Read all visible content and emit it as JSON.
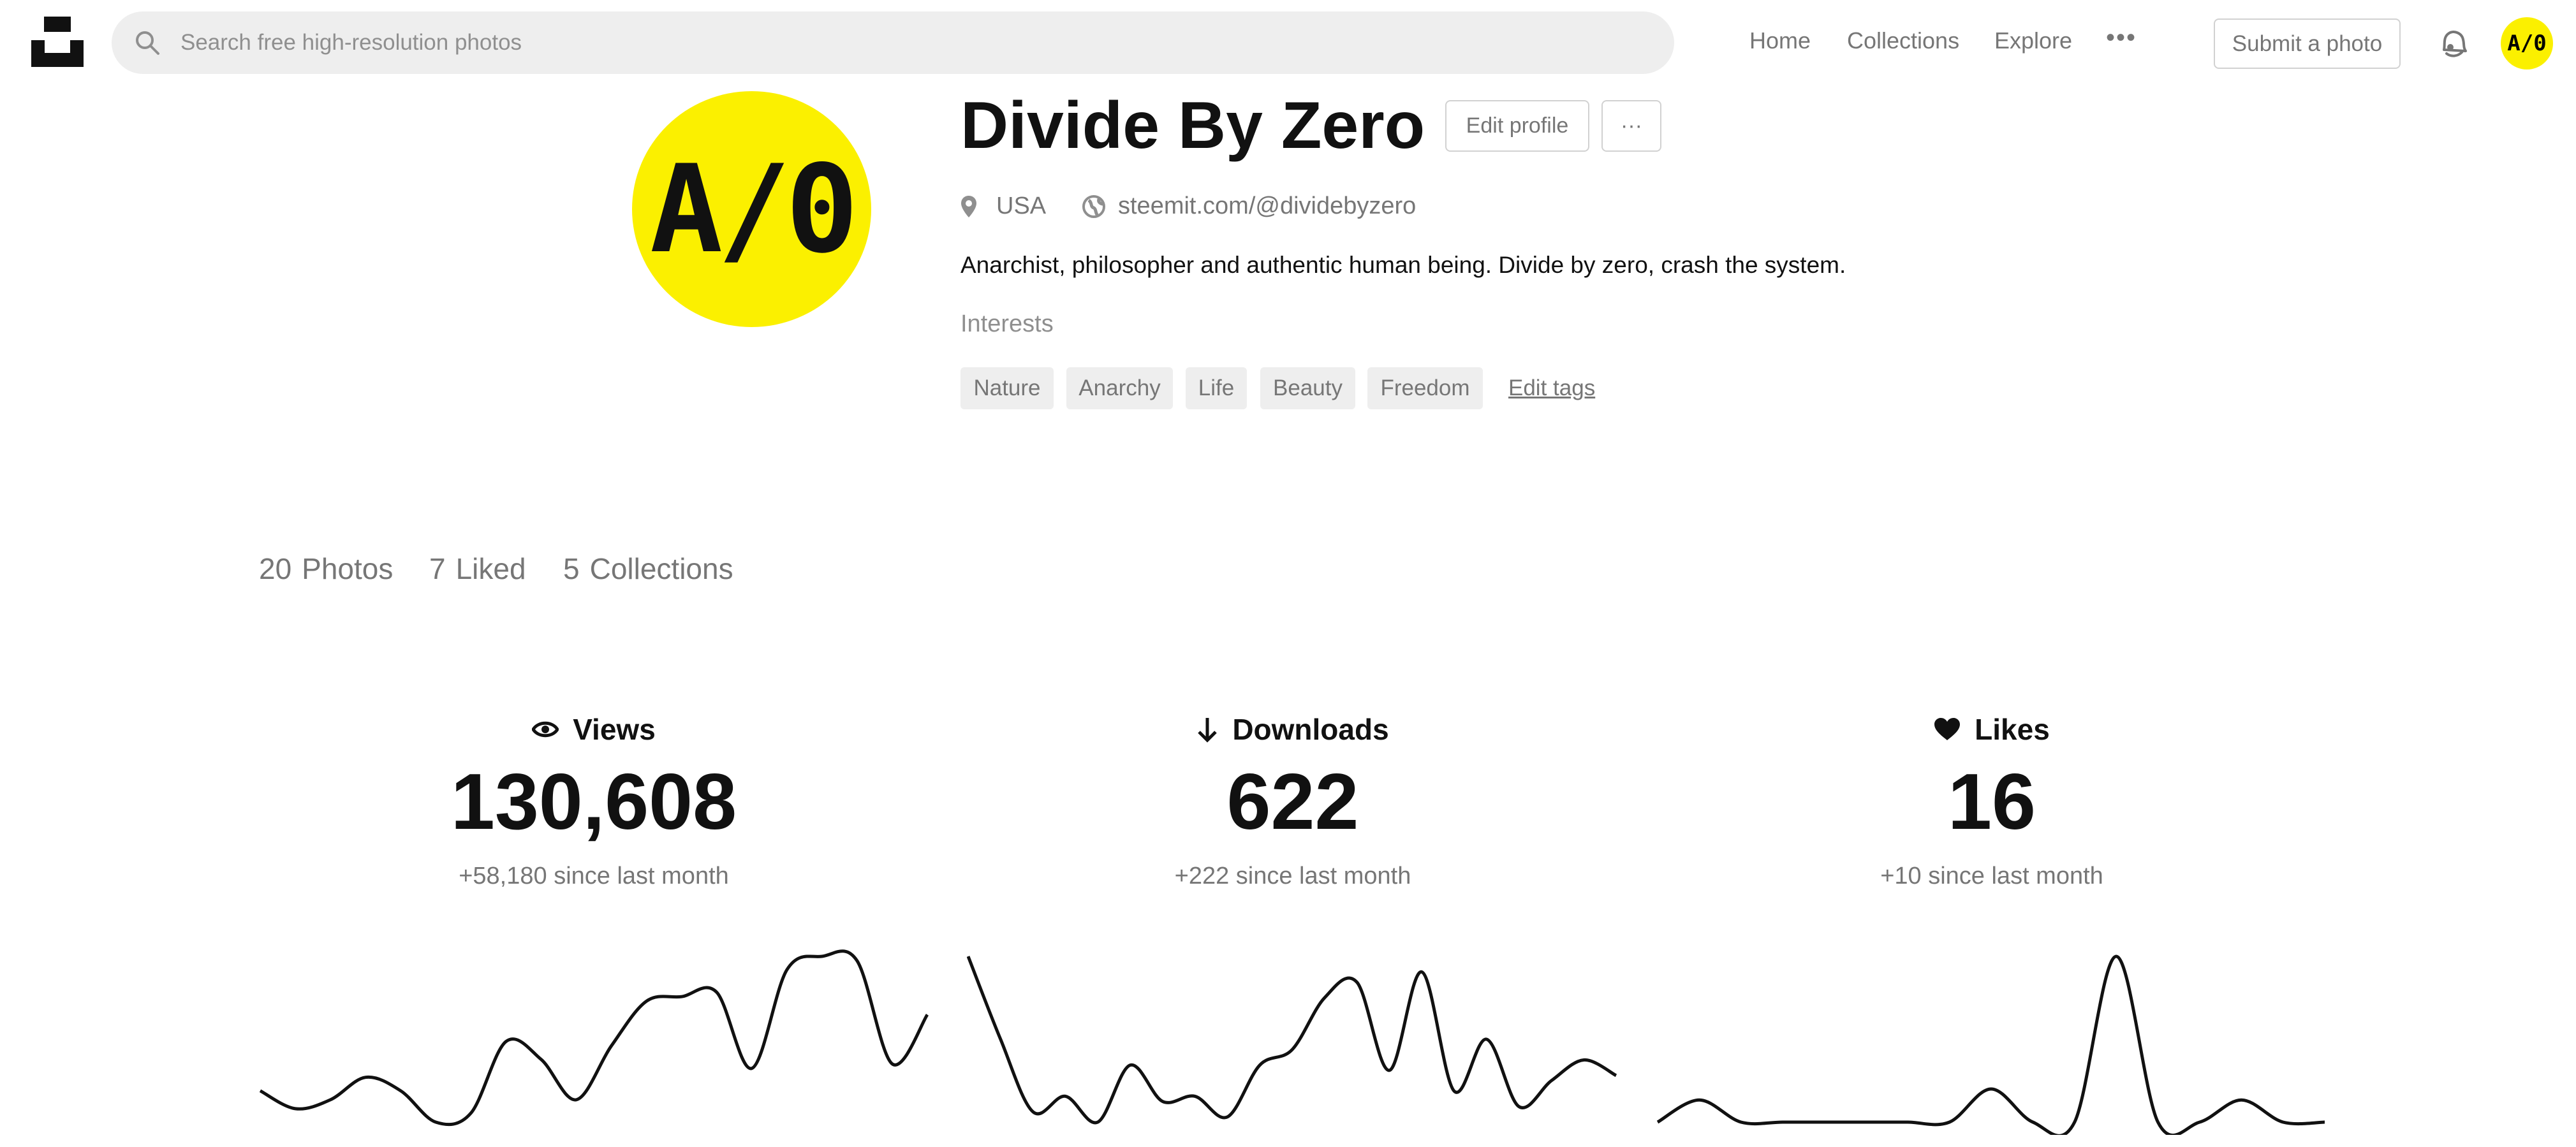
{
  "header": {
    "logo": "unsplash-logo",
    "search_placeholder": "Search free high-resolution photos",
    "nav": [
      "Home",
      "Collections",
      "Explore"
    ],
    "more_label": "•••",
    "submit_label": "Submit a photo",
    "avatar_text": "A/0"
  },
  "profile": {
    "avatar_text": "A/0",
    "name": "Divide By Zero",
    "edit_profile_label": "Edit profile",
    "more_label": "···",
    "location": "USA",
    "website": "steemit.com/@dividebyzero",
    "bio": "Anarchist, philosopher and authentic human being. Divide by zero, crash the system.",
    "interests_label": "Interests",
    "tags": [
      "Nature",
      "Anarchy",
      "Life",
      "Beauty",
      "Freedom"
    ],
    "edit_tags_label": "Edit tags",
    "accent_color": "#fbf000"
  },
  "counts": {
    "photos": {
      "value": "20",
      "label": "Photos"
    },
    "liked": {
      "value": "7",
      "label": "Liked"
    },
    "collections": {
      "value": "5",
      "label": "Collections"
    }
  },
  "stats": [
    {
      "icon": "eye-icon",
      "label": "Views",
      "value": "130,608",
      "change": "+58,180 since last month"
    },
    {
      "icon": "arrow-down-icon",
      "label": "Downloads",
      "value": "622",
      "change": "+222 since last month"
    },
    {
      "icon": "heart-icon",
      "label": "Likes",
      "value": "16",
      "change": "+10 since last month"
    }
  ],
  "chart_data": [
    {
      "type": "line",
      "name": "Views",
      "values": [
        9,
        5,
        7,
        12,
        9,
        2,
        4,
        20,
        16,
        7,
        19,
        29,
        30,
        31,
        14,
        36,
        39,
        38,
        15,
        26
      ]
    },
    {
      "type": "line",
      "name": "Downloads",
      "values": [
        34,
        18,
        4,
        7,
        2,
        13,
        6,
        7,
        3,
        13,
        16,
        26,
        29,
        12,
        31,
        8,
        18,
        5,
        10,
        14,
        11
      ]
    },
    {
      "type": "line",
      "name": "Likes",
      "values": [
        0,
        4,
        0,
        0,
        0,
        0,
        0,
        0,
        6,
        0,
        0,
        30,
        0,
        0,
        4,
        0,
        0
      ]
    }
  ]
}
